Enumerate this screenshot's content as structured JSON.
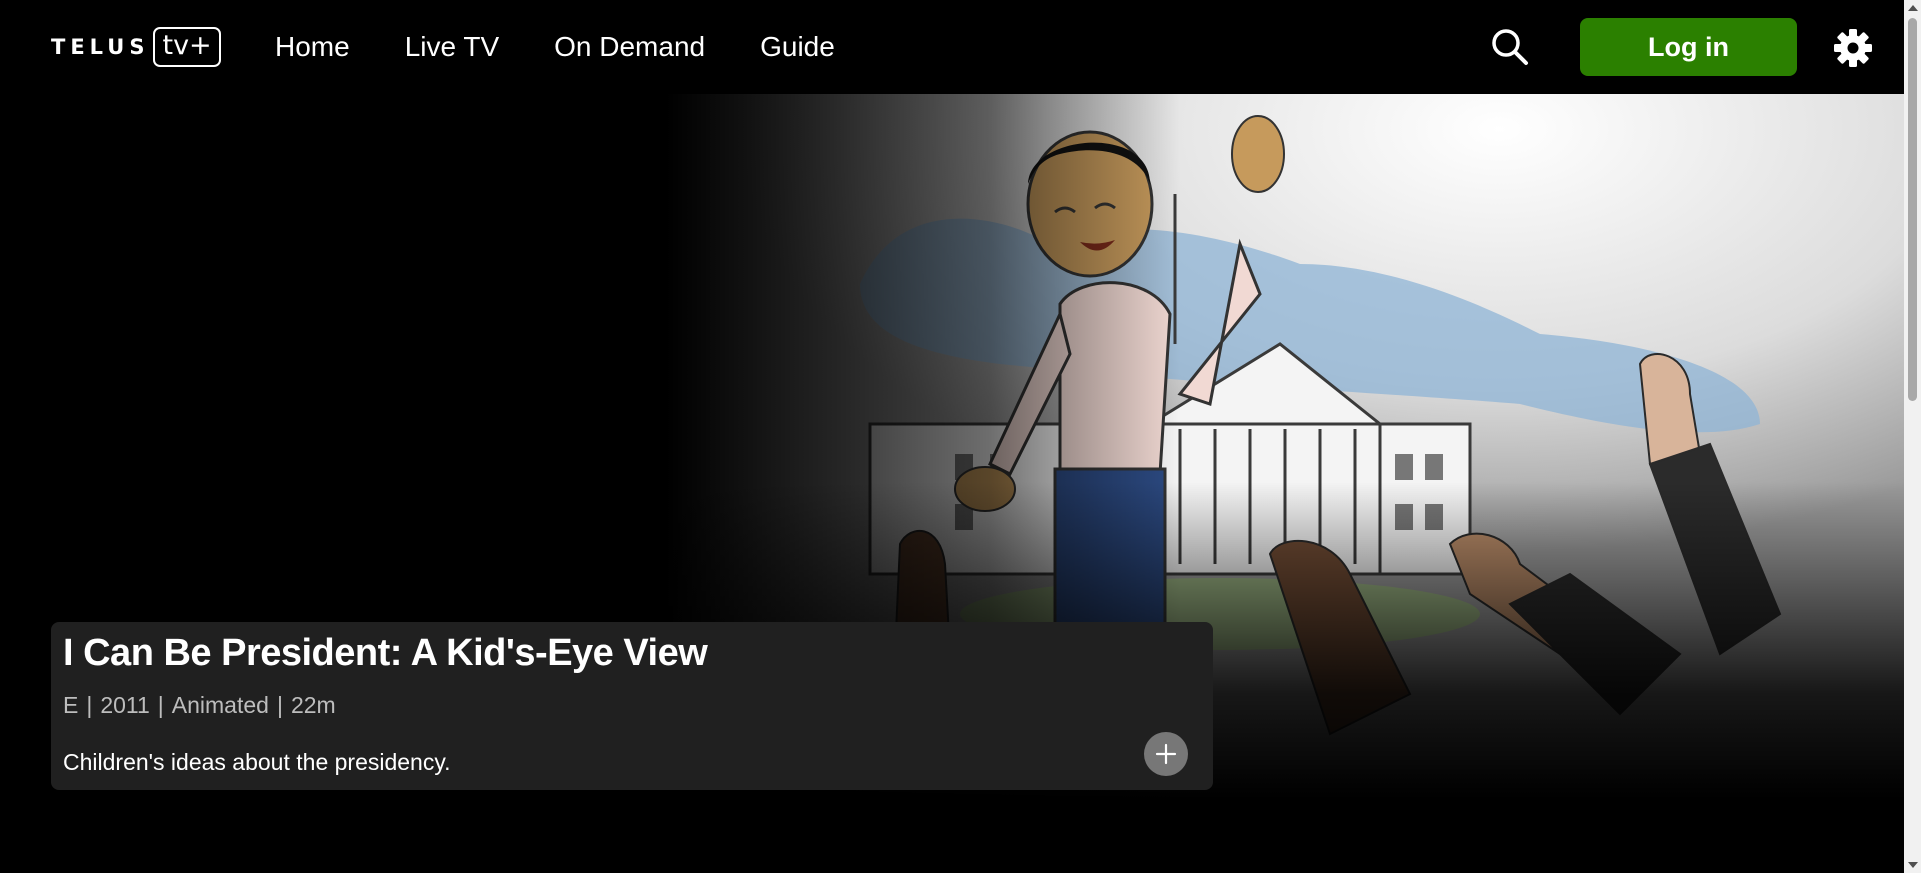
{
  "header": {
    "logo_word": "TELUS",
    "logo_box": "tv+",
    "nav": [
      {
        "label": "Home"
      },
      {
        "label": "Live TV"
      },
      {
        "label": "On Demand"
      },
      {
        "label": "Guide"
      }
    ],
    "login_label": "Log in",
    "icons": {
      "search": "search-icon",
      "settings": "gear-icon"
    },
    "login_color": "#2b8000"
  },
  "feature": {
    "title": "I Can Be President: A Kid's-Eye View",
    "meta": {
      "rating": "E",
      "year": "2011",
      "genre": "Animated",
      "duration": "22m",
      "separator": "|"
    },
    "description": "Children's ideas about the presidency.",
    "add_icon": "plus-icon"
  }
}
